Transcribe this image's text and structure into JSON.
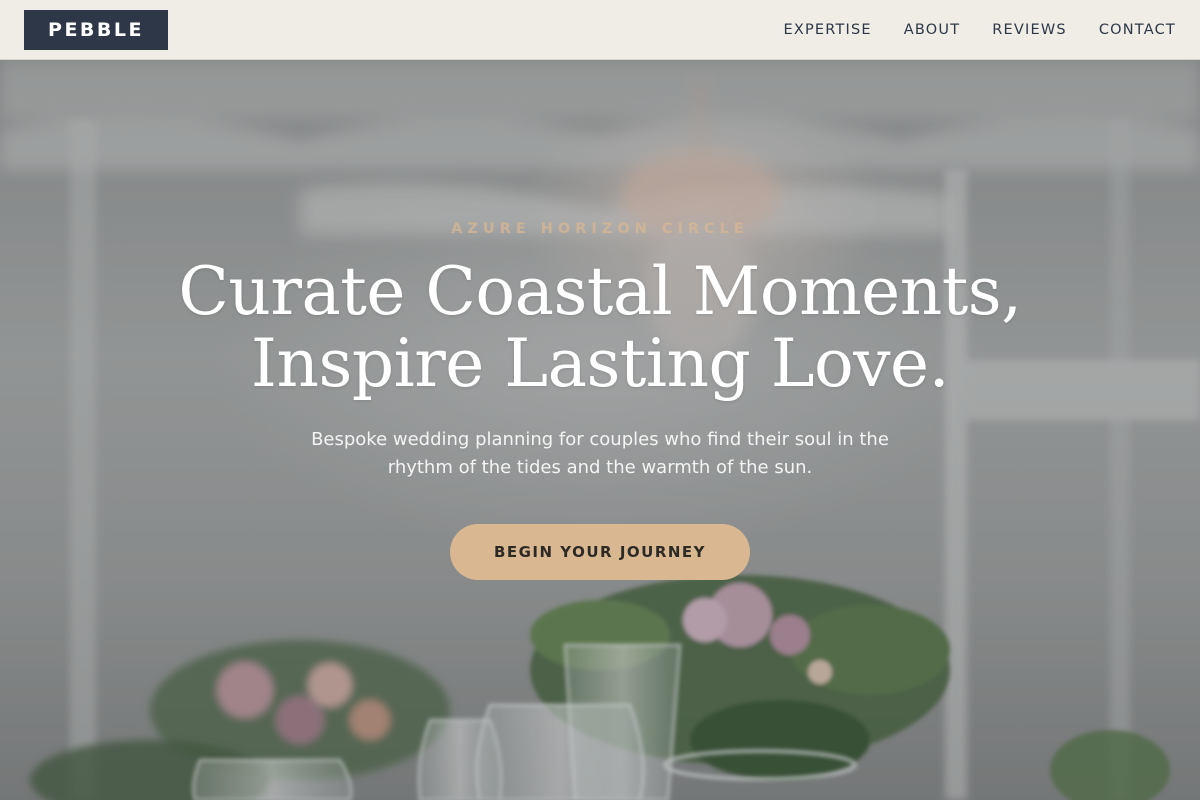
{
  "header": {
    "logo": "PEBBLE",
    "nav": [
      {
        "label": "EXPERTISE"
      },
      {
        "label": "ABOUT"
      },
      {
        "label": "REVIEWS"
      },
      {
        "label": "CONTACT"
      }
    ]
  },
  "hero": {
    "eyebrow": "AZURE HORIZON CIRCLE",
    "headline_line1": "Curate Coastal Moments,",
    "headline_line2": "Inspire Lasting Love.",
    "subtext_line1": "Bespoke wedding planning for couples who find their soul in the",
    "subtext_line2": "rhythm of the tides and the warmth of the sun.",
    "cta_label": "BEGIN YOUR JOURNEY",
    "background_description_icon": "wedding-table-photo"
  },
  "colors": {
    "header_bg": "#efede6",
    "logo_bg": "#2d3748",
    "accent_gold": "#d9b791",
    "nav_text": "#2d3748"
  }
}
